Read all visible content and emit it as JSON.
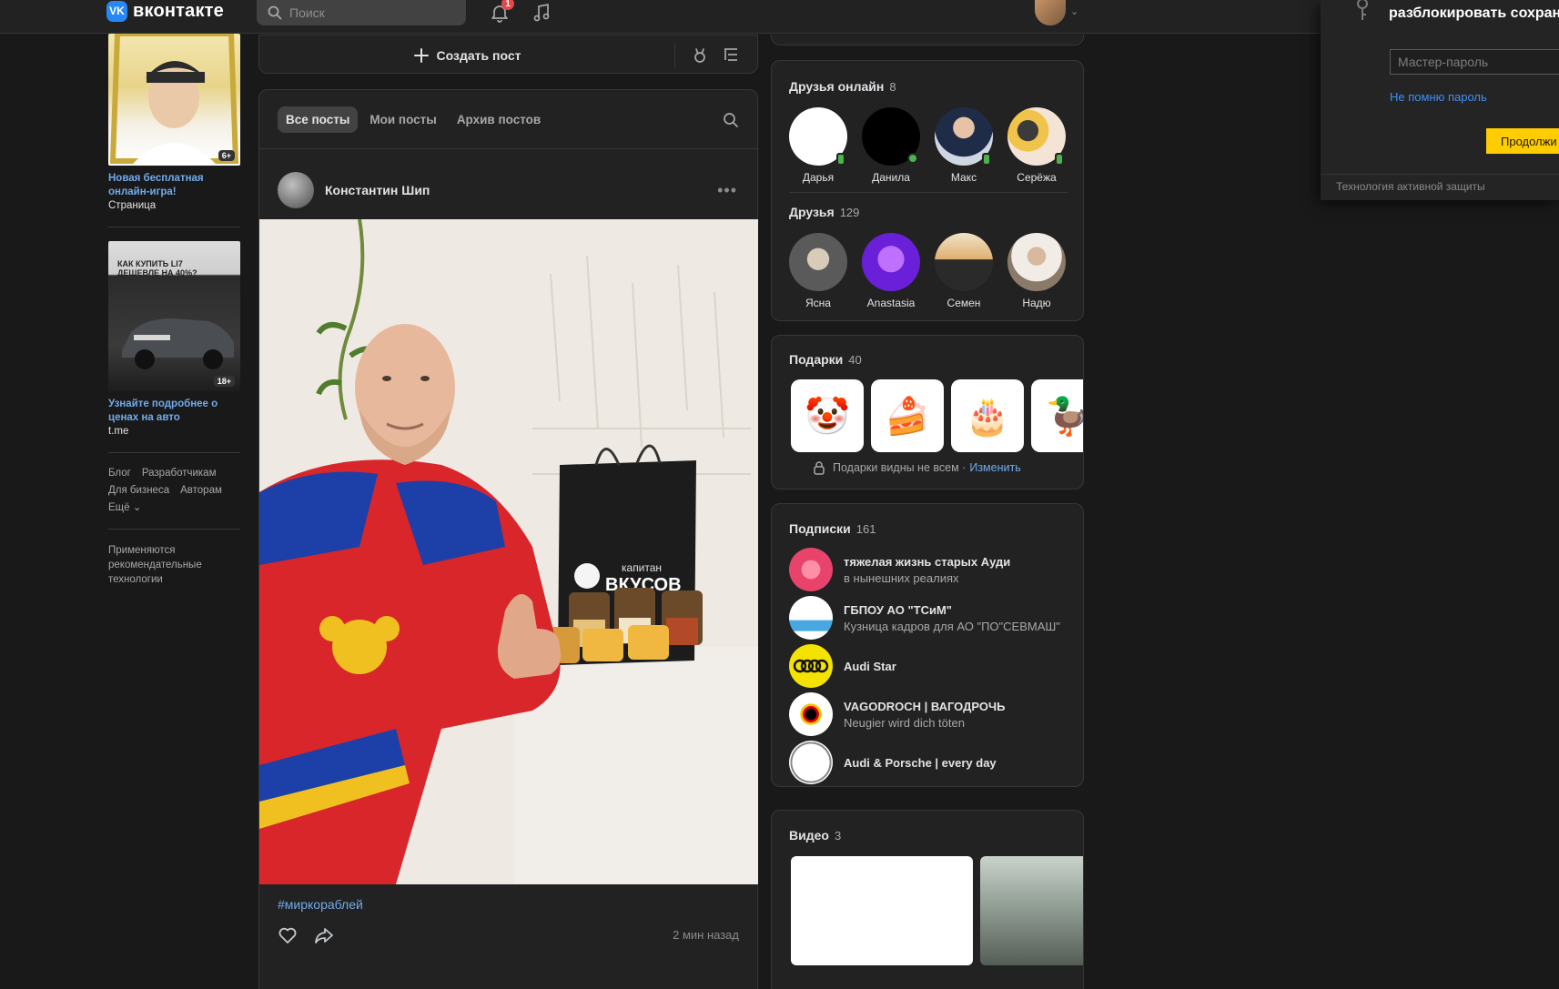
{
  "header": {
    "logo_text": "вконтакте",
    "logo_mark": "VK",
    "search_placeholder": "Поиск",
    "notifications_badge": "1",
    "icons": [
      "search-icon",
      "bell-icon",
      "music-icon",
      "chevron-down-icon"
    ]
  },
  "left_ads": [
    {
      "title": "Новая бесплатная онлайн-игра!",
      "subtitle": "Страница",
      "age": "6+"
    },
    {
      "title": "Узнайте подробнее о ценах на авто",
      "subtitle": "t.me",
      "age": "18+",
      "banner_text": "КАК КУПИТЬ LI7 ДЕШЕВЛЕ НА 40%?"
    }
  ],
  "footer_links": [
    "Блог",
    "Разработчикам",
    "Для бизнеса",
    "Авторам",
    "Ещё"
  ],
  "footer_note": "Применяются рекомендательные технологии",
  "create_post": {
    "label": "Создать пост"
  },
  "feed": {
    "tabs": [
      {
        "label": "Все посты",
        "active": true
      },
      {
        "label": "Мои посты",
        "active": false
      },
      {
        "label": "Архив постов",
        "active": false
      }
    ],
    "post": {
      "author": "Константин Шип",
      "hashtag": "#миркораблей",
      "time": "2 мин назад",
      "photo_text_top": "капитан",
      "photo_text_brand": "ВКУСОВ"
    }
  },
  "friends_online": {
    "title": "Друзья онлайн",
    "count": "8",
    "items": [
      "Дарья",
      "Данила",
      "Макс",
      "Серёжа"
    ]
  },
  "friends": {
    "title": "Друзья",
    "count": "129",
    "items": [
      "Ясна",
      "Anastasia",
      "Семен",
      "Надю"
    ]
  },
  "gifts": {
    "title": "Подарки",
    "count": "40",
    "note": "Подарки видны не всем ·",
    "change_link": "Изменить"
  },
  "subscriptions": {
    "title": "Подписки",
    "count": "161",
    "items": [
      {
        "name": "тяжелая жизнь старых Ауди",
        "desc": "в нынешних реалиях"
      },
      {
        "name": "ГБПОУ АО \"ТСиМ\"",
        "desc": "Кузница кадров для АО \"ПО\"СЕВМАШ\""
      },
      {
        "name": "Audi Star",
        "desc": ""
      },
      {
        "name": "VAGODROCH | ВАГОДРОЧЬ",
        "desc": "Neugier wird dich töten"
      },
      {
        "name": "Audi & Porsche | every day",
        "desc": ""
      }
    ]
  },
  "videos": {
    "title": "Видео",
    "count": "3"
  },
  "password_popup": {
    "title": "разблокировать сохран",
    "input_placeholder": "Мастер-пароль",
    "forgot_link": "Не помню пароль",
    "continue_button": "Продолжи",
    "footer": "Технология активной защиты"
  },
  "colors": {
    "background": "#191919",
    "card": "#222222",
    "accent_link": "#71aaeb",
    "online": "#4bb34b",
    "badge": "#e64646",
    "cta_yellow": "#ffcc00"
  }
}
